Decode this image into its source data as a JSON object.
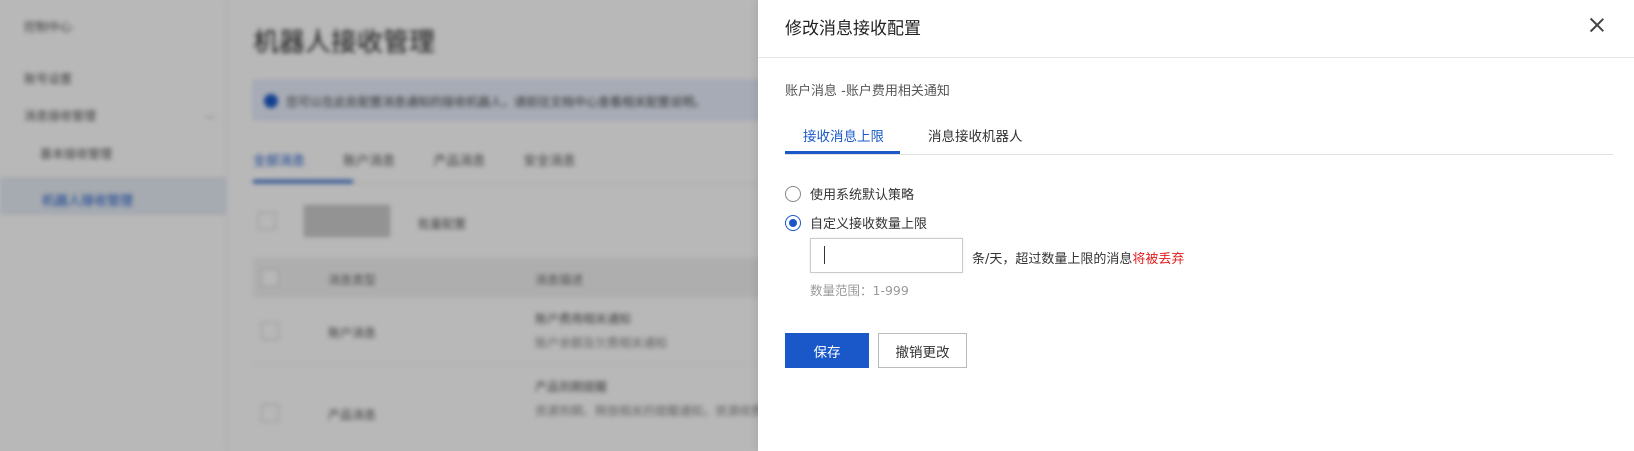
{
  "background": {
    "sidebar": {
      "logo": "控制中心",
      "items": [
        "账号设置",
        "消息接收管理",
        "基本接收管理"
      ],
      "active_item": "机器人接收管理"
    },
    "main": {
      "title": "机器人接收管理",
      "notice": "您可以在此处配置消息通知的接收机器人，请前往文档中心查看相关配置说明。",
      "tabs": [
        "全部消息",
        "账户消息",
        "产品消息",
        "安全消息"
      ],
      "batch_button": "批量配置",
      "table": {
        "headers": [
          "消息类型",
          "消息描述"
        ],
        "rows": [
          {
            "type": "账户消息",
            "desc": "账户费用相关通知",
            "desc2": "账户余额及欠费相关通知"
          },
          {
            "type": "产品消息",
            "desc": "产品到期提醒",
            "desc2": "资源到期、释放相关的提醒通知，资源续费相关通知"
          }
        ]
      }
    }
  },
  "drawer": {
    "title": "修改消息接收配置",
    "subtitle": "账户消息 -账户费用相关通知",
    "tabs": [
      {
        "label": "接收消息上限",
        "active": true
      },
      {
        "label": "消息接收机器人",
        "active": false
      }
    ],
    "options": [
      {
        "label": "使用系统默认策略",
        "checked": false
      },
      {
        "label": "自定义接收数量上限",
        "checked": true
      }
    ],
    "limit_input": {
      "value": "",
      "placeholder": ""
    },
    "unit_text": "条/天，超过数量上限的消息",
    "warn_text": "将被丢弃",
    "range_hint": "数量范围：1-999",
    "save_label": "保存",
    "revert_label": "撤销更改"
  },
  "colors": {
    "accent": "#1a58c9",
    "warning": "#e02020"
  },
  "icons": {
    "close": "close-icon",
    "collapse": "chevron-left-icon"
  }
}
